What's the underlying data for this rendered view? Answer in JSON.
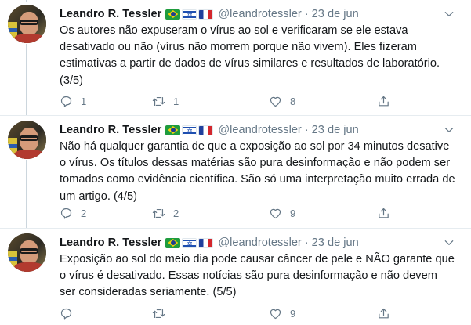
{
  "tweets": [
    {
      "name": "Leandro R. Tessler",
      "handle": "@leandrotessler",
      "separator": "·",
      "date": "23 de jun",
      "text": "Os autores não expuseram o vírus ao sol e verificaram se ele estava desativado ou não (vírus não morrem porque não vivem). Eles fizeram estimativas a partir de dados de vírus similares e resultados de laboratório. (3/5)",
      "replies": "1",
      "retweets": "1",
      "likes": "8"
    },
    {
      "name": "Leandro R. Tessler",
      "handle": "@leandrotessler",
      "separator": "·",
      "date": "23 de jun",
      "text": "Não há qualquer garantia de que a exposição ao sol por 34 minutos desative o vírus. Os títulos dessas matérias são pura desinformação e não podem ser tomados como evidência científica. São só uma interpretação muito errada de um artigo. (4/5)",
      "replies": "2",
      "retweets": "2",
      "likes": "9"
    },
    {
      "name": "Leandro R. Tessler",
      "handle": "@leandrotessler",
      "separator": "·",
      "date": "23 de jun",
      "text": "Exposição ao sol do meio dia pode causar câncer de pele e NÃO garante que o vírus é desativado. Essas notícias são pura desinformação e não devem ser consideradas seriamente. (5/5)",
      "replies": "",
      "retweets": "",
      "likes": "9"
    }
  ],
  "icons": {
    "flags": [
      "brazil-flag-icon",
      "israel-flag-icon",
      "france-flag-icon"
    ],
    "actions": [
      "reply-icon",
      "retweet-icon",
      "like-icon",
      "share-icon"
    ],
    "menu": "chevron-down-icon"
  },
  "colors": {
    "text_primary": "#14171a",
    "text_secondary": "#657786",
    "thread_line": "#ccd6dd",
    "divider": "#e6ecf0"
  }
}
